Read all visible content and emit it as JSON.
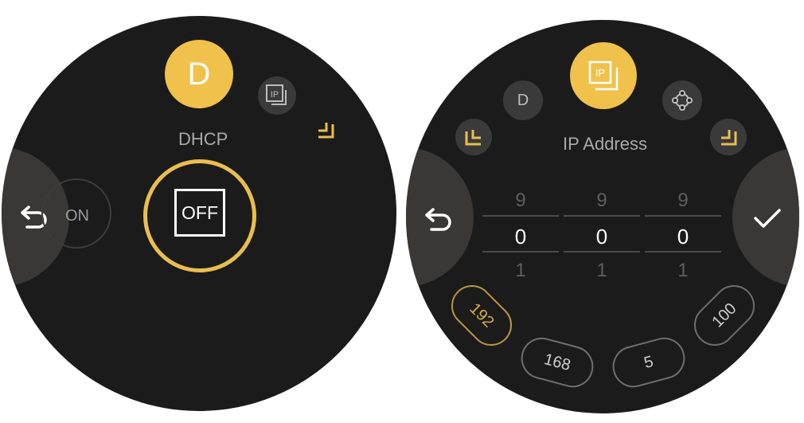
{
  "left": {
    "avatar_letter": "D",
    "title": "DHCP",
    "on_label": "ON",
    "off_label": "OFF",
    "ip_icon_text": "IP"
  },
  "right": {
    "ip_icon_text": "IP",
    "d_letter": "D",
    "title": "IP Address",
    "columns": [
      {
        "above": "9",
        "value": "0",
        "below": "1"
      },
      {
        "above": "9",
        "value": "0",
        "below": "1"
      },
      {
        "above": "9",
        "value": "0",
        "below": "1"
      }
    ],
    "octets": [
      "192",
      "168",
      "5",
      "100"
    ]
  },
  "colors": {
    "accent": "#f0c14b",
    "background": "#1c1b1b",
    "panel": "#393836"
  }
}
